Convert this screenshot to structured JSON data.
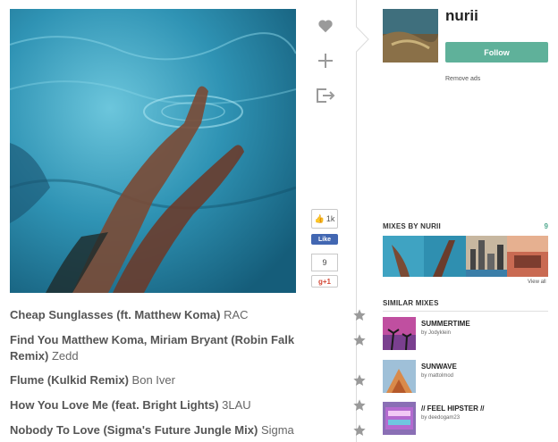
{
  "artist": {
    "name": "nurii",
    "follow_label": "Follow",
    "remove_ads_label": "Remove ads"
  },
  "social": {
    "facebook_count": "1k",
    "facebook_like_label": "Like",
    "google_count": "9",
    "google_plus_label": "g+1"
  },
  "mixes_by": {
    "heading": "MIXES BY NURII",
    "count": "9",
    "view_all_label": "View all"
  },
  "similar_mixes": {
    "heading": "SIMILAR MIXES",
    "items": [
      {
        "title": "SUMMERTIME",
        "by": "by Jodyklein"
      },
      {
        "title": "SUNWAVE",
        "by": "by mattolmod"
      },
      {
        "title": "// FEEL HIPSTER //",
        "by": "by deedogam23"
      }
    ]
  },
  "tracks": [
    {
      "title": "Cheap Sunglasses (ft. Matthew Koma)",
      "artist": "RAC"
    },
    {
      "title": "Find You Matthew Koma, Miriam Bryant (Robin Falk",
      "title_cont": "Remix)",
      "artist": "Zedd"
    },
    {
      "title": "Flume (Kulkid Remix)",
      "artist": "Bon Iver"
    },
    {
      "title": "How You Love Me (feat. Bright Lights)",
      "artist": "3LAU"
    },
    {
      "title": "Nobody To Love (Sigma's Future Jungle Mix)",
      "artist": "Sigma"
    }
  ],
  "icons": {
    "like": "heart-icon",
    "add": "plus-icon",
    "share": "share-icon",
    "favorite": "star-icon"
  },
  "colors": {
    "accent": "#5fb19a",
    "facebook": "#4267b2",
    "google": "#d34836",
    "icon_gray": "#9a9a9a"
  }
}
